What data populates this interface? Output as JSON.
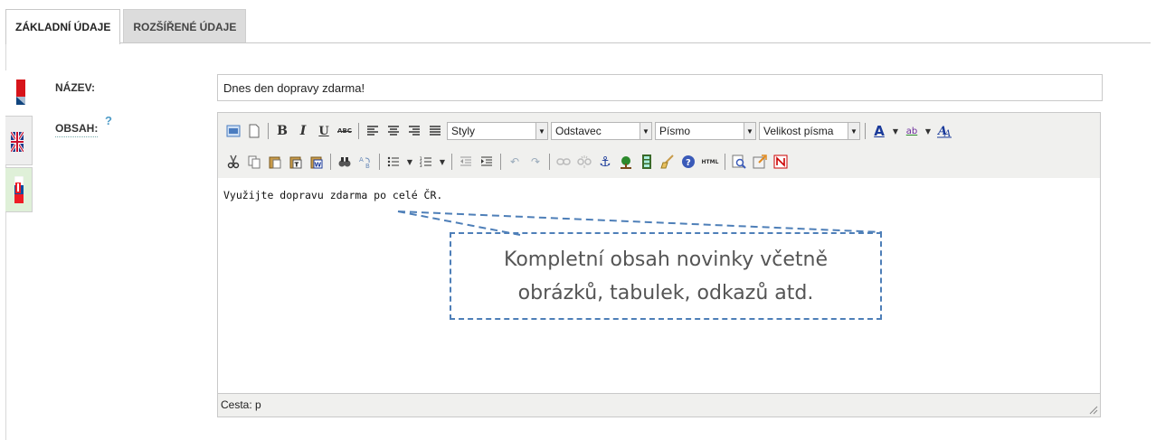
{
  "tabs": [
    {
      "label": "ZÁKLADNÍ ÚDAJE",
      "active": true
    },
    {
      "label": "ROZŠÍŘENÉ ÚDAJE",
      "active": false
    }
  ],
  "languages": [
    "cz-flag-icon",
    "gb-flag-icon",
    "sk-flag-icon"
  ],
  "form": {
    "title_label": "NÁZEV:",
    "title_value": "Dnes den dopravy zdarma!",
    "content_label": "OBSAH:",
    "help_mark": "?"
  },
  "editor": {
    "toolbar_row1_icons": [
      "full-page-icon",
      "new-document-icon",
      "bold-icon",
      "italic-icon",
      "underline-icon",
      "strikethrough-icon",
      "align-left-icon",
      "align-center-icon",
      "align-right-icon",
      "align-justify-icon"
    ],
    "bold_glyph": "B",
    "italic_glyph": "I",
    "underline_glyph": "U",
    "strike_glyph": "ABC",
    "styles_select": "Styly",
    "paragraph_select": "Odstavec",
    "font_select": "Písmo",
    "size_select": "Velikost písma",
    "forecolor_glyph": "A",
    "backcolor_glyph": "ab",
    "toolbar_row2_icons": [
      "cut-icon",
      "copy-icon",
      "paste-icon",
      "paste-text-icon",
      "paste-word-icon",
      "find-icon",
      "replace-icon",
      "bullet-list-icon",
      "numbered-list-icon",
      "outdent-icon",
      "indent-icon",
      "undo-icon",
      "redo-icon",
      "link-icon",
      "unlink-icon",
      "anchor-icon",
      "image-icon",
      "media-icon",
      "cleanup-icon",
      "help-icon",
      "html-icon",
      "preview-icon",
      "insert-file-icon",
      "template-icon"
    ],
    "html_glyph": "HTML",
    "content_text": "Využijte dopravu zdarma po celé ČR.",
    "status_path": "Cesta: p"
  },
  "annotation": {
    "line1": "Kompletní obsah novinky včetně",
    "line2": "obrázků, tabulek, odkazů atd."
  },
  "colors": {
    "annotation_border": "#4e7fb8",
    "toolbar_bg": "#f0f0ee",
    "inactive_tab": "#dcdcdc"
  }
}
